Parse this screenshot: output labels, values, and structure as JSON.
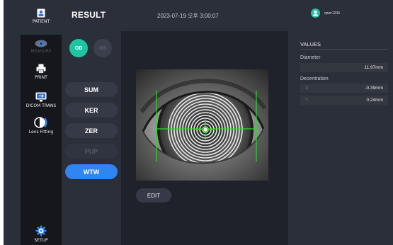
{
  "header": {
    "title": "RESULT",
    "datetime": "2023-07-19 오후 3:00:07",
    "user": "qwer1234"
  },
  "sidebar": {
    "items": [
      {
        "label": "PATIENT",
        "icon": "patient-icon"
      },
      {
        "label": "MEASURE",
        "icon": "eye-icon"
      },
      {
        "label": "PRINT",
        "icon": "printer-icon"
      },
      {
        "label": "DICOM TRANS",
        "icon": "monitor-transfer-icon"
      },
      {
        "label": "Lens Fitting",
        "icon": "lens-icon"
      },
      {
        "label": "SETUP",
        "icon": "gear-icon"
      }
    ]
  },
  "eye_select": {
    "od": "OD",
    "os": "OS",
    "selected": "OD"
  },
  "modes": [
    "SUM",
    "KER",
    "ZER",
    "PUP",
    "WTW"
  ],
  "active_mode": "WTW",
  "edit_label": "EDIT",
  "values": {
    "title": "VALUES",
    "diameter_label": "Diameter",
    "diameter_value": "11.97mm",
    "decentration_label": "Decentration",
    "x_label": "X",
    "x_value": "-0.39mm",
    "y_label": "Y",
    "y_value": "0.24mm"
  },
  "colors": {
    "accent_teal": "#1fc5a3",
    "accent_blue": "#2f86f0",
    "overlay_green": "#22dd22",
    "sidebar_bg": "#15171d",
    "panel_bg": "#2b2f3a"
  }
}
